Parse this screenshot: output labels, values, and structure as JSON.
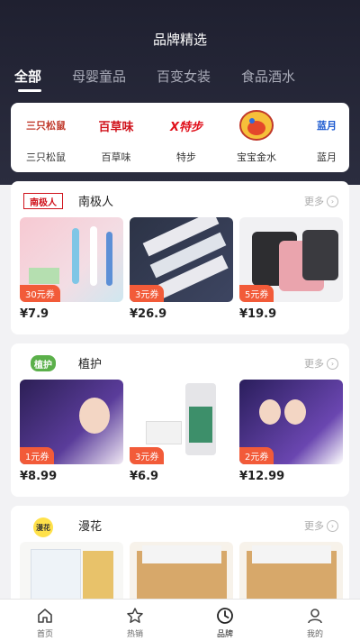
{
  "header": {
    "title": "品牌精选"
  },
  "tabs": [
    {
      "label": "全部",
      "active": true
    },
    {
      "label": "母婴童品",
      "active": false
    },
    {
      "label": "百变女装",
      "active": false
    },
    {
      "label": "食品酒水",
      "active": false
    }
  ],
  "brands": [
    {
      "logo_text": "三只松鼠",
      "logo_color": "#c0392b",
      "name": "三只松鼠"
    },
    {
      "logo_text": "百草味",
      "logo_color": "#d0121b",
      "name": "百草味"
    },
    {
      "logo_text": "X特步",
      "logo_color": "#e0101b",
      "name": "特步"
    },
    {
      "logo_text": "宝宝金水",
      "logo_color": "#e8a01e",
      "name": "宝宝金水"
    },
    {
      "logo_text": "蓝月",
      "logo_color": "#1e5bd0",
      "name": "蓝月"
    }
  ],
  "sections": [
    {
      "brand": "南极人",
      "logo_text": "南极人",
      "logo_color": "#d0121b",
      "more_label": "更多",
      "products": [
        {
          "price": "¥7.9",
          "coupon": "30元券"
        },
        {
          "price": "¥26.9",
          "coupon": "3元券"
        },
        {
          "price": "¥19.9",
          "coupon": "5元券"
        }
      ]
    },
    {
      "brand": "植护",
      "logo_text": "植护",
      "logo_color": "#5bb04a",
      "more_label": "更多",
      "products": [
        {
          "price": "¥8.99",
          "coupon": "1元券"
        },
        {
          "price": "¥6.9",
          "coupon": "3元券"
        },
        {
          "price": "¥12.99",
          "coupon": "2元券"
        }
      ]
    },
    {
      "brand": "漫花",
      "logo_text": "漫花",
      "logo_color": "#e8b800",
      "more_label": "更多",
      "products": []
    }
  ],
  "bottom_nav": [
    {
      "label": "首页",
      "icon": "home-icon",
      "active": false
    },
    {
      "label": "热销",
      "icon": "star-icon",
      "active": false
    },
    {
      "label": "品牌",
      "icon": "clock-icon",
      "active": true
    },
    {
      "label": "我的",
      "icon": "user-icon",
      "active": false
    }
  ],
  "colors": {
    "header_bg": "#23243a",
    "coupon": "#f25b39"
  }
}
